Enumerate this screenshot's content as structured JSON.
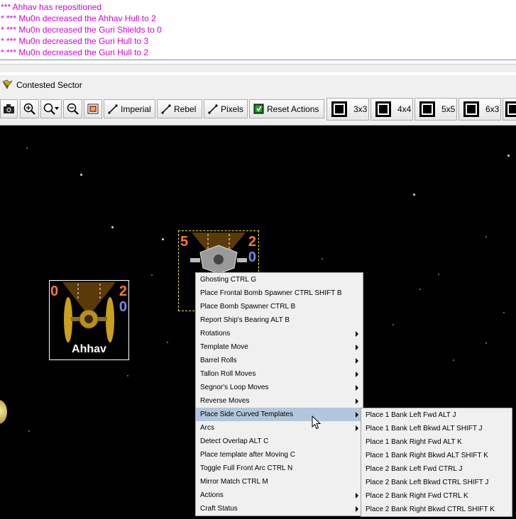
{
  "log": {
    "lines": [
      "*** Ahhav has repositioned",
      "* *** Mu0n decreased the Ahhav Hull to 2",
      "* *** Mu0n decreased the Guri Shields to 0",
      "* *** Mu0n decreased the Guri Hull to 3",
      "* *** Mu0n decreased the Guri Hull to 2"
    ],
    "color": "#d400d4"
  },
  "window": {
    "title": "Contested Sector",
    "icon": "vassal-icon"
  },
  "toolbar": {
    "camera": "camera-icon",
    "zoom_in": "zoom-in-icon",
    "zoom_select": "zoom-dropdown-icon",
    "zoom_out": "zoom-out-icon",
    "overview": "map-overview-icon",
    "imperial": "Imperial",
    "rebel": "Rebel",
    "pixels": "Pixels",
    "reset_actions": "Reset Actions",
    "grids": [
      "3x3",
      "4x4",
      "5x5",
      "6x3"
    ]
  },
  "ships": [
    {
      "name": "Ahhav",
      "left_stat": "0",
      "right_top": "2",
      "right_bottom": "0",
      "label": "Ahhav"
    },
    {
      "name": "Guri",
      "left_stat": "5",
      "right_top": "2",
      "right_bottom": "0"
    }
  ],
  "context_menu": {
    "items": [
      {
        "label": "Ghosting  CTRL G",
        "submenu": false
      },
      {
        "label": "Place Frontal Bomb Spawner  CTRL SHIFT B",
        "submenu": false
      },
      {
        "label": "Place Bomb Spawner  CTRL B",
        "submenu": false
      },
      {
        "label": "Report Ship's Bearing  ALT B",
        "submenu": false
      },
      {
        "label": "Rotations",
        "submenu": true
      },
      {
        "label": "Template Move",
        "submenu": true
      },
      {
        "label": "Barrel Rolls",
        "submenu": true
      },
      {
        "label": "Tallon Roll Moves",
        "submenu": true
      },
      {
        "label": "Segnor's Loop Moves",
        "submenu": true
      },
      {
        "label": "Reverse Moves",
        "submenu": true
      },
      {
        "label": "Place Side Curved Templates",
        "submenu": true,
        "highlighted": true
      },
      {
        "label": "Arcs",
        "submenu": true
      },
      {
        "label": "Detect Overlap  ALT C",
        "submenu": false
      },
      {
        "label": "Place template after Moving  C",
        "submenu": false
      },
      {
        "label": "Toggle Full Front Arc  CTRL N",
        "submenu": false
      },
      {
        "label": "Mirror Match  CTRL M",
        "submenu": false
      },
      {
        "label": "Actions",
        "submenu": true
      },
      {
        "label": "Craft Status",
        "submenu": true
      }
    ]
  },
  "submenu": {
    "items": [
      "Place 1 Bank Left Fwd  ALT J",
      "Place 1 Bank Left Bkwd  ALT SHIFT J",
      "Place 1 Bank Right Fwd  ALT K",
      "Place 1 Bank Right Bkwd  ALT SHIFT K",
      "Place 2 Bank Left Fwd  CTRL J",
      "Place 2 Bank Left Bkwd  CTRL SHIFT J",
      "Place 2 Bank Right Fwd  CTRL K",
      "Place 2 Bank Right Bkwd  CTRL SHIFT K"
    ]
  },
  "colors": {
    "highlight": "#b3c6dc",
    "stat_orange": "#ff7a2a",
    "stat_blue": "#7b86e8",
    "space": "#000000"
  }
}
